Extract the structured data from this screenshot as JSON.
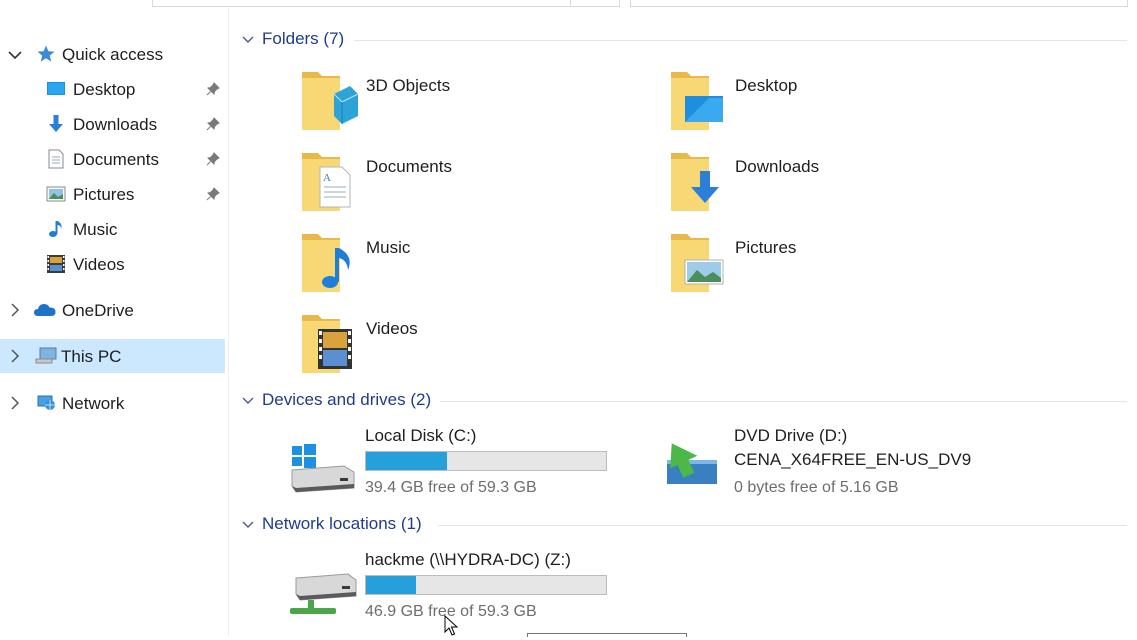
{
  "nav": {
    "quick_access": "Quick access",
    "quick_items": [
      {
        "label": "Desktop",
        "icon": "desktop-icon",
        "pinned": true
      },
      {
        "label": "Downloads",
        "icon": "download-arrow-icon",
        "pinned": true
      },
      {
        "label": "Documents",
        "icon": "document-icon",
        "pinned": true
      },
      {
        "label": "Pictures",
        "icon": "pictures-icon",
        "pinned": true
      },
      {
        "label": "Music",
        "icon": "music-note-icon",
        "pinned": false
      },
      {
        "label": "Videos",
        "icon": "film-icon",
        "pinned": false
      }
    ],
    "onedrive": "OneDrive",
    "this_pc": "This PC",
    "network": "Network",
    "selected": "This PC"
  },
  "groups": {
    "folders": "Folders (7)",
    "devices": "Devices and drives (2)",
    "network": "Network locations (1)"
  },
  "folders": [
    {
      "name": "3D Objects"
    },
    {
      "name": "Desktop"
    },
    {
      "name": "Documents"
    },
    {
      "name": "Downloads"
    },
    {
      "name": "Music"
    },
    {
      "name": "Pictures"
    },
    {
      "name": "Videos"
    }
  ],
  "drives": {
    "c": {
      "name": "Local Disk (C:)",
      "free_text": "39.4 GB free of 59.3 GB",
      "used_fraction": 0.336
    },
    "d": {
      "name": "DVD Drive (D:)",
      "label": "CENA_X64FREE_EN-US_DV9",
      "free_text": "0 bytes free of 5.16 GB"
    }
  },
  "network_locations": {
    "z": {
      "name": "hackme (\\\\HYDRA-DC) (Z:)",
      "free_text": "46.9 GB free of 59.3 GB",
      "used_fraction": 0.209
    }
  },
  "colors": {
    "selection": "#cce8ff",
    "progress": "#26a0da",
    "group_header": "#1f3b8c",
    "folder_yellow": "#f8d775"
  }
}
